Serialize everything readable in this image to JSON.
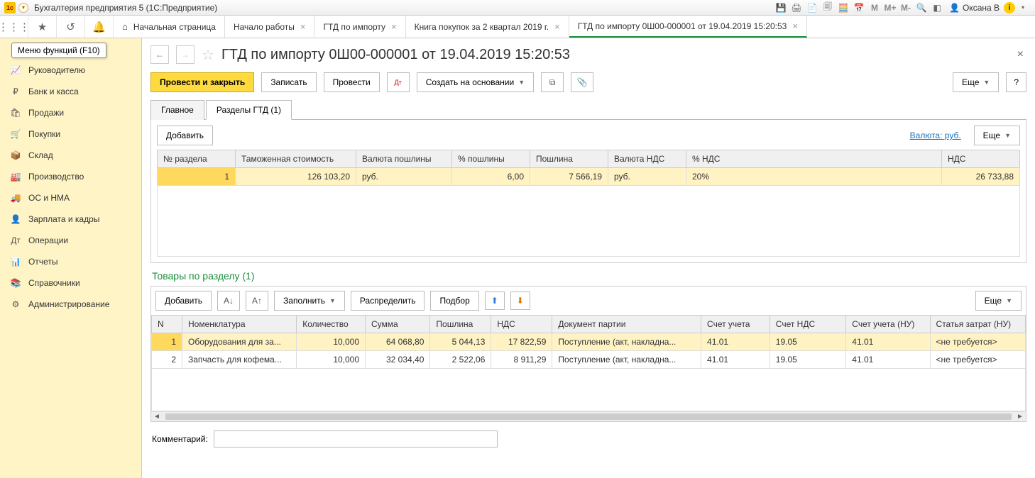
{
  "titlebar": {
    "app_title": "Бухгалтерия предприятия 5   (1С:Предприятие)",
    "markers": [
      "M",
      "M+",
      "M-"
    ],
    "user": "Оксана В"
  },
  "tabs": {
    "home": "Начальная страница",
    "t1": "Начало работы",
    "t2": "ГТД по импорту",
    "t3": "Книга покупок за 2 квартал 2019 г.",
    "t4": "ГТД по импорту 0Ш00-000001 от 19.04.2019 15:20:53"
  },
  "tooltip": "Меню функций (F10)",
  "sidebar": {
    "items": [
      {
        "icon": "📈",
        "label": "Руководителю"
      },
      {
        "icon": "₽",
        "label": "Банк и касса"
      },
      {
        "icon": "🛍",
        "label": "Продажи"
      },
      {
        "icon": "🛒",
        "label": "Покупки"
      },
      {
        "icon": "📦",
        "label": "Склад"
      },
      {
        "icon": "🏭",
        "label": "Производство"
      },
      {
        "icon": "🚚",
        "label": "ОС и НМА"
      },
      {
        "icon": "👤",
        "label": "Зарплата и кадры"
      },
      {
        "icon": "Дт",
        "label": "Операции"
      },
      {
        "icon": "📊",
        "label": "Отчеты"
      },
      {
        "icon": "📚",
        "label": "Справочники"
      },
      {
        "icon": "⚙",
        "label": "Администрирование"
      }
    ]
  },
  "page": {
    "title": "ГТД по импорту 0Ш00-000001 от 19.04.2019 15:20:53"
  },
  "actions": {
    "post_close": "Провести и закрыть",
    "save": "Записать",
    "post": "Провести",
    "create_based": "Создать на основании",
    "more": "Еще",
    "help": "?"
  },
  "formtabs": {
    "main": "Главное",
    "sections": "Разделы ГТД (1)"
  },
  "sections": {
    "add": "Добавить",
    "currency_label": "Валюта: руб.",
    "more": "Еще",
    "headers": {
      "num": "№ раздела",
      "customs_val": "Таможенная стоимость",
      "duty_cur": "Валюта пошлины",
      "duty_pct": "% пошлины",
      "duty": "Пошлина",
      "vat_cur": "Валюта НДС",
      "vat_pct": "% НДС",
      "vat": "НДС"
    },
    "row": {
      "num": "1",
      "customs_val": "126 103,20",
      "duty_cur": "руб.",
      "duty_pct": "6,00",
      "duty": "7 566,19",
      "vat_cur": "руб.",
      "vat_pct": "20%",
      "vat": "26 733,88"
    }
  },
  "goods": {
    "title": "Товары по разделу (1)",
    "add": "Добавить",
    "fill": "Заполнить",
    "distribute": "Распределить",
    "pick": "Подбор",
    "more": "Еще",
    "headers": {
      "n": "N",
      "nomen": "Номенклатура",
      "qty": "Количество",
      "sum": "Сумма",
      "duty": "Пошлина",
      "vat": "НДС",
      "batch_doc": "Документ партии",
      "acct": "Счет учета",
      "vat_acct": "Счет НДС",
      "acct_nu": "Счет учета (НУ)",
      "cost_item": "Статья затрат (НУ)"
    },
    "rows": [
      {
        "n": "1",
        "nomen": "Оборудования для за...",
        "qty": "10,000",
        "sum": "64 068,80",
        "duty": "5 044,13",
        "vat": "17 822,59",
        "batch": "Поступление (акт, накладна...",
        "acct": "41.01",
        "vat_acct": "19.05",
        "acct_nu": "41.01",
        "cost": "<не требуется>"
      },
      {
        "n": "2",
        "nomen": "Запчасть для кофема...",
        "qty": "10,000",
        "sum": "32 034,40",
        "duty": "2 522,06",
        "vat": "8 911,29",
        "batch": "Поступление (акт, накладна...",
        "acct": "41.01",
        "vat_acct": "19.05",
        "acct_nu": "41.01",
        "cost": "<не требуется>"
      }
    ]
  },
  "comment": {
    "label": "Комментарий:",
    "value": ""
  }
}
